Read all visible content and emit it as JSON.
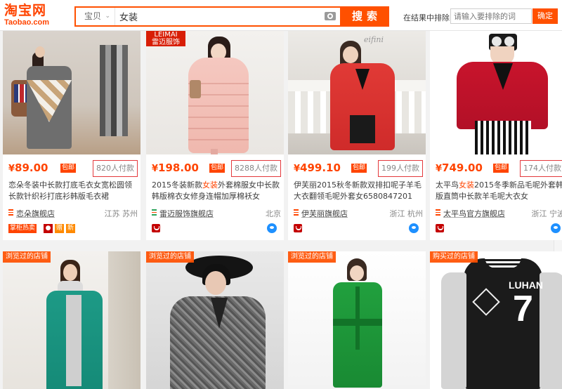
{
  "header": {
    "logo_cn": "淘宝网",
    "logo_en": "Taobao.com",
    "search": {
      "scope": "宝贝",
      "query": "女装",
      "button": "搜索"
    },
    "filter": {
      "label": "在结果中排除",
      "placeholder": "请输入要排除的词",
      "button": "确定"
    }
  },
  "products": [
    {
      "price": "89.00",
      "free_shipping": "包邮",
      "sales": "820人付款",
      "title_pre": "恋朵冬装中长款打底毛衣女宽松圆领长款针织衫打底衫韩版毛衣裙",
      "title_hl": "",
      "title_post": "",
      "shop": "恋朵旗舰店",
      "location": "江苏 苏州",
      "tags": [
        "掌柜热卖"
      ],
      "tag_glyph": "赠",
      "tag_glyph2": "新"
    },
    {
      "price": "198.00",
      "free_shipping": "包邮",
      "sales": "8288人付款",
      "title_pre": "2015冬装新款",
      "title_hl": "女装",
      "title_post": "外套棉服女中长款韩版棉衣女修身连帽加厚棉袄女",
      "shop": "雷迈服饰旗舰店",
      "location": "北京",
      "brand_tag_1": "LEIMAI",
      "brand_tag_2": "雷迈服饰"
    },
    {
      "price": "499.10",
      "free_shipping": "包邮",
      "sales": "199人付款",
      "title_pre": "伊芙丽2015秋冬新款双排扣呢子羊毛大衣翻领毛呢外套女6580847201",
      "title_hl": "",
      "title_post": "",
      "shop": "伊芙丽旗舰店",
      "location": "浙江 杭州",
      "watermark": "eifini"
    },
    {
      "price": "749.00",
      "free_shipping": "包邮",
      "sales": "174人付款",
      "title_pre": "太平鸟",
      "title_hl": "女装",
      "title_post": "2015冬季新品毛呢外套韩版直筒中长款羊毛呢大衣女",
      "shop": "太平鸟官方旗舰店",
      "location": "浙江 宁波"
    },
    {
      "badge": "浏览过的店铺"
    },
    {
      "badge": "浏览过的店铺"
    },
    {
      "badge": "浏览过的店铺"
    },
    {
      "badge": "购买过的店铺",
      "jacket_name": "LUHAN",
      "jacket_number": "7"
    }
  ],
  "colors": {
    "accent": "#ff5000",
    "price": "#ff4400",
    "sales_border": "#e4393c"
  }
}
